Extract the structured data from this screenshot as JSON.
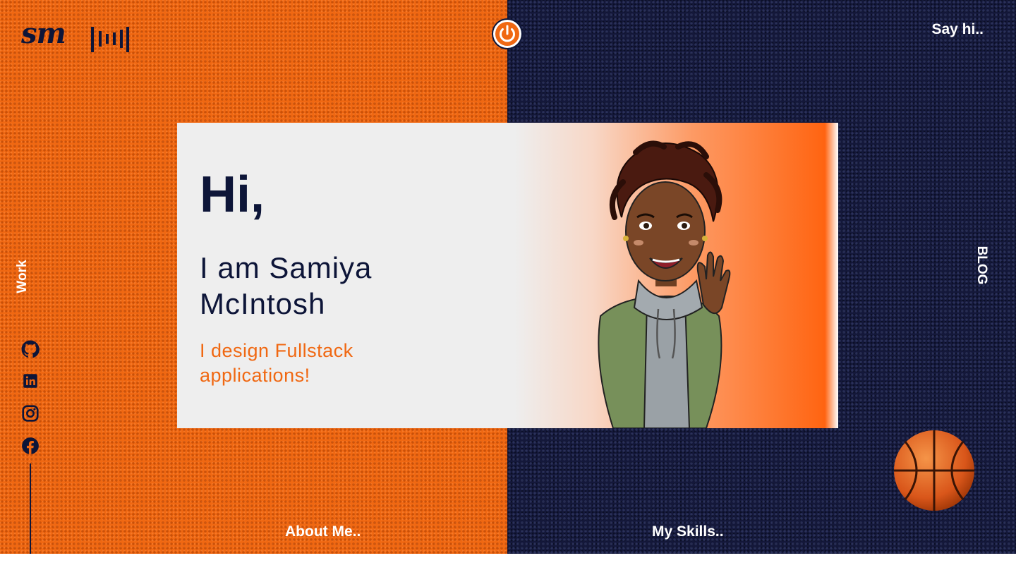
{
  "header": {
    "logo_text": "sm",
    "music_icon": "music-bars-icon",
    "power_icon": "power-icon",
    "contact_label": "Say hi.."
  },
  "nav": {
    "work_label": "Work",
    "blog_label": "BLOG",
    "about_label": "About Me..",
    "skills_label": "My Skills.."
  },
  "social": [
    {
      "name": "github",
      "icon": "github-icon"
    },
    {
      "name": "linkedin",
      "icon": "linkedin-icon"
    },
    {
      "name": "instagram",
      "icon": "instagram-icon"
    },
    {
      "name": "facebook",
      "icon": "facebook-icon"
    }
  ],
  "hero": {
    "greeting": "Hi,",
    "name": "I am Samiya McIntosh",
    "tagline": "I design Fullstack applications!",
    "avatar": "waving-cartoon-avatar"
  },
  "decor": {
    "ball_icon": "basketball-icon"
  },
  "colors": {
    "orange": "#f06812",
    "navy": "#14183a",
    "text_dark": "#0d1538",
    "card_bg": "#eeeeee",
    "accent_orange": "#ff6411"
  }
}
